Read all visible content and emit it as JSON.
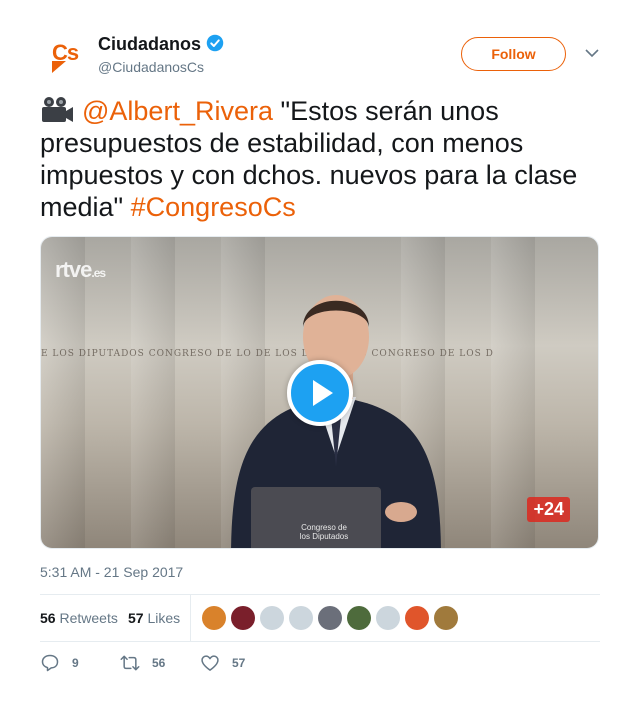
{
  "account": {
    "name": "Ciudadanos",
    "handle": "@CiudadanosCs",
    "logo_text": "Cs",
    "verified": true
  },
  "follow_label": "Follow",
  "tweet": {
    "emoji_icon": "movie-camera-icon",
    "mention": "@Albert_Rivera",
    "text": " \"Estos serán unos presupuestos de estabilidad, con menos impuestos y con dchos. nuevos para la clase media\" ",
    "hashtag": "#CongresoCs"
  },
  "media": {
    "broadcaster": "rtve",
    "broadcaster_suffix": ".es",
    "channel_badge": "+24",
    "banner_text": "E LOS DIPUTADOS     CONGRESO DE LO     DE LOS DIPUTADOS     CONGRESO DE LOS D",
    "podium_label": "Congreso de los Diputados"
  },
  "timestamp": "5:31 AM - 21 Sep 2017",
  "stats": {
    "retweets_count": "56",
    "retweets_label": "Retweets",
    "likes_count": "57",
    "likes_label": "Likes"
  },
  "liker_avatar_colors": [
    "#d9822b",
    "#7a1f2b",
    "#ccd6dd",
    "#ccd6dd",
    "#6b6f7a",
    "#4e6b3c",
    "#ccd6dd",
    "#e0552b",
    "#a07a3c"
  ],
  "actions": {
    "reply_count": "9",
    "retweet_count": "56",
    "like_count": "57"
  },
  "colors": {
    "brand": "#eb6109",
    "verified": "#1da1f2",
    "muted": "#657786"
  }
}
